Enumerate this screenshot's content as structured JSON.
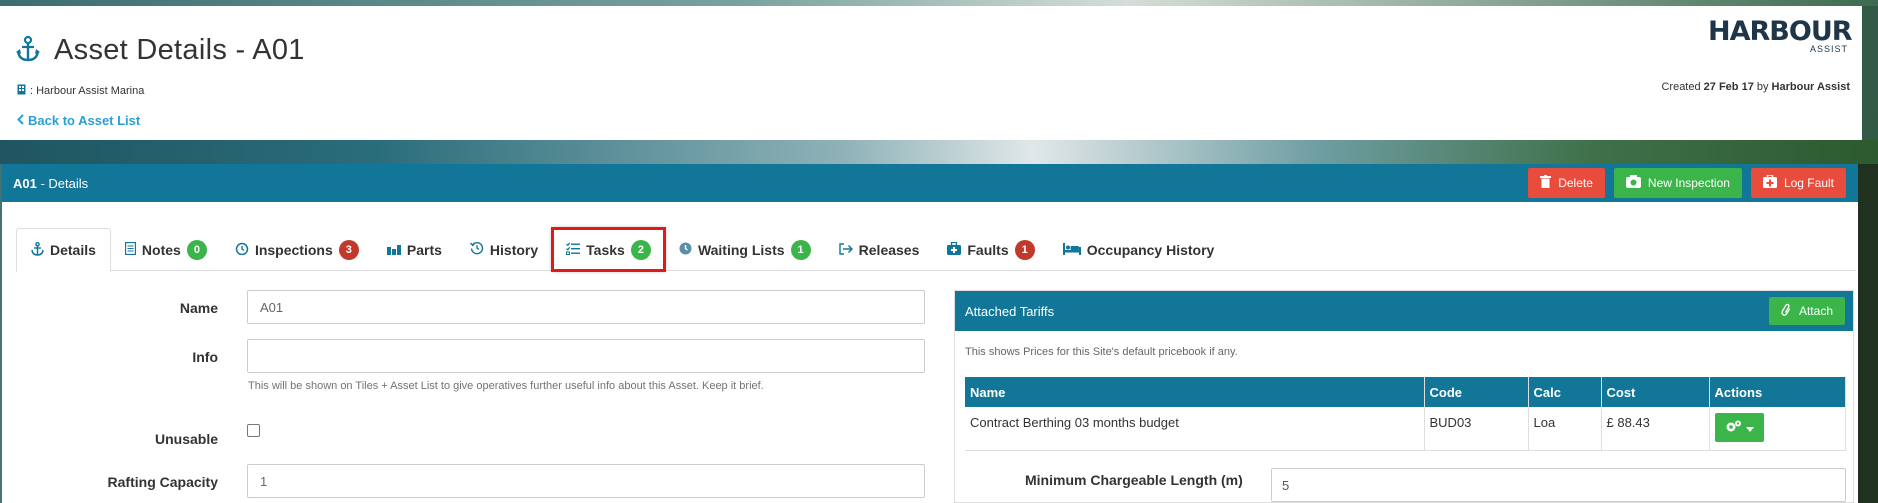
{
  "header": {
    "title": "Asset Details - A01",
    "site": ": Harbour Assist Marina",
    "back_label": "Back to Asset List",
    "logo_main": "HARBOUR",
    "logo_sub": "ASSIST",
    "created_prefix": "Created ",
    "created_date": "27 Feb 17",
    "created_by_word": " by ",
    "created_by": "Harbour Assist"
  },
  "panel": {
    "asset_code": "A01",
    "details_suffix": " - Details",
    "buttons": {
      "delete": "Delete",
      "new_inspection": "New Inspection",
      "log_fault": "Log Fault"
    }
  },
  "tabs": [
    {
      "label": "Details",
      "icon": "anchor-icon",
      "active": true
    },
    {
      "label": "Notes",
      "icon": "note-icon",
      "badge": "0",
      "badge_color": "#3bb54a"
    },
    {
      "label": "Inspections",
      "icon": "inspection-icon",
      "badge": "3",
      "badge_color": "#c0392b"
    },
    {
      "label": "Parts",
      "icon": "parts-icon"
    },
    {
      "label": "History",
      "icon": "history-icon"
    },
    {
      "label": "Tasks",
      "icon": "tasks-icon",
      "badge": "2",
      "badge_color": "#3bb54a",
      "highlighted": true
    },
    {
      "label": "Waiting Lists",
      "icon": "clock-icon",
      "badge": "1",
      "badge_color": "#3bb54a"
    },
    {
      "label": "Releases",
      "icon": "release-icon"
    },
    {
      "label": "Faults",
      "icon": "fault-icon",
      "badge": "1",
      "badge_color": "#c0392b"
    },
    {
      "label": "Occupancy History",
      "icon": "bed-icon"
    }
  ],
  "form": {
    "name_label": "Name",
    "name_value": "A01",
    "info_label": "Info",
    "info_value": "",
    "info_help": "This will be shown on Tiles + Asset List to give operatives further useful info about this Asset. Keep it brief.",
    "unusable_label": "Unusable",
    "rafting_label": "Rafting Capacity",
    "rafting_value": "1"
  },
  "tariffs": {
    "title": "Attached Tariffs",
    "attach_label": "Attach",
    "info": "This shows Prices for this Site's default pricebook if any.",
    "columns": [
      "Name",
      "Code",
      "Calc",
      "Cost",
      "Actions"
    ],
    "rows": [
      {
        "name": "Contract Berthing 03 months budget",
        "code": "BUD03",
        "calc": "Loa",
        "cost": "£ 88.43"
      }
    ],
    "min_length_label": "Minimum Chargeable Length (m)",
    "min_length_value": "5"
  },
  "colors": {
    "primary": "#117698",
    "success": "#3bb54a",
    "danger": "#e74c3c",
    "link": "#2a9fd6",
    "highlight": "#e0191b"
  }
}
